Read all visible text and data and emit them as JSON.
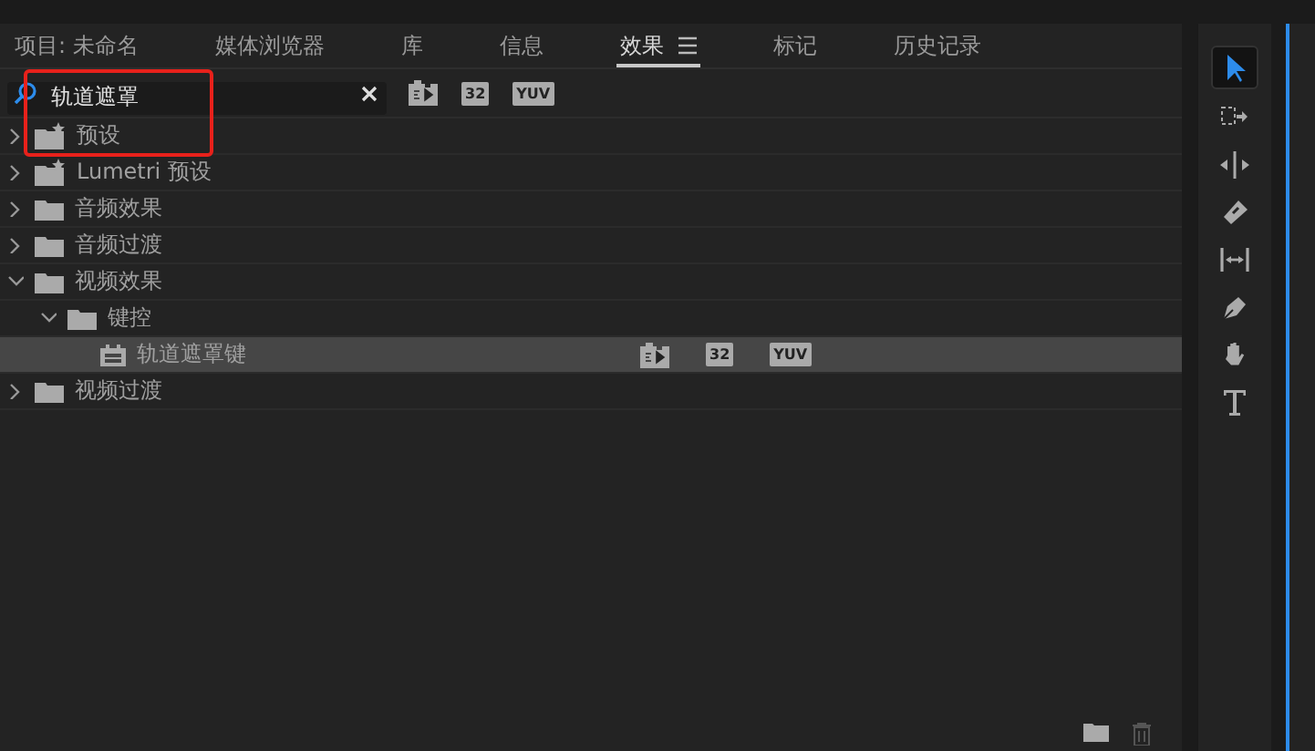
{
  "tabs": [
    {
      "label": "项目: 未命名",
      "selected": false
    },
    {
      "label": "媒体浏览器",
      "selected": false
    },
    {
      "label": "库",
      "selected": false
    },
    {
      "label": "信息",
      "selected": false
    },
    {
      "label": "效果",
      "selected": true
    },
    {
      "label": "标记",
      "selected": false
    },
    {
      "label": "历史记录",
      "selected": false
    }
  ],
  "search": {
    "value": "轨道遮罩"
  },
  "filters": [
    {
      "kind": "accelerated"
    },
    {
      "kind": "text",
      "label": "32"
    },
    {
      "kind": "text",
      "label": "YUV"
    }
  ],
  "tree": [
    {
      "label": "预设",
      "kind": "preset",
      "expanded": false
    },
    {
      "label": "Lumetri 预设",
      "kind": "preset",
      "expanded": false
    },
    {
      "label": "音频效果",
      "kind": "folder",
      "expanded": false
    },
    {
      "label": "音频过渡",
      "kind": "folder",
      "expanded": false
    },
    {
      "label": "视频效果",
      "kind": "folder",
      "expanded": true,
      "children": [
        {
          "label": "键控",
          "kind": "folder",
          "expanded": true,
          "children": [
            {
              "label": "轨道遮罩键",
              "kind": "effect",
              "selected": true,
              "badges": [
                {
                  "kind": "accelerated"
                },
                {
                  "kind": "text",
                  "label": "32"
                },
                {
                  "kind": "text",
                  "label": "YUV"
                }
              ]
            }
          ]
        }
      ]
    },
    {
      "label": "视频过渡",
      "kind": "folder",
      "expanded": false
    }
  ],
  "tools": [
    {
      "kind": "select",
      "selected": true
    },
    {
      "kind": "track",
      "selected": false
    },
    {
      "kind": "ripple",
      "selected": false
    },
    {
      "kind": "razor",
      "selected": false
    },
    {
      "kind": "slip",
      "selected": false
    },
    {
      "kind": "pen",
      "selected": false
    },
    {
      "kind": "hand",
      "selected": false
    },
    {
      "kind": "type",
      "selected": false
    }
  ]
}
